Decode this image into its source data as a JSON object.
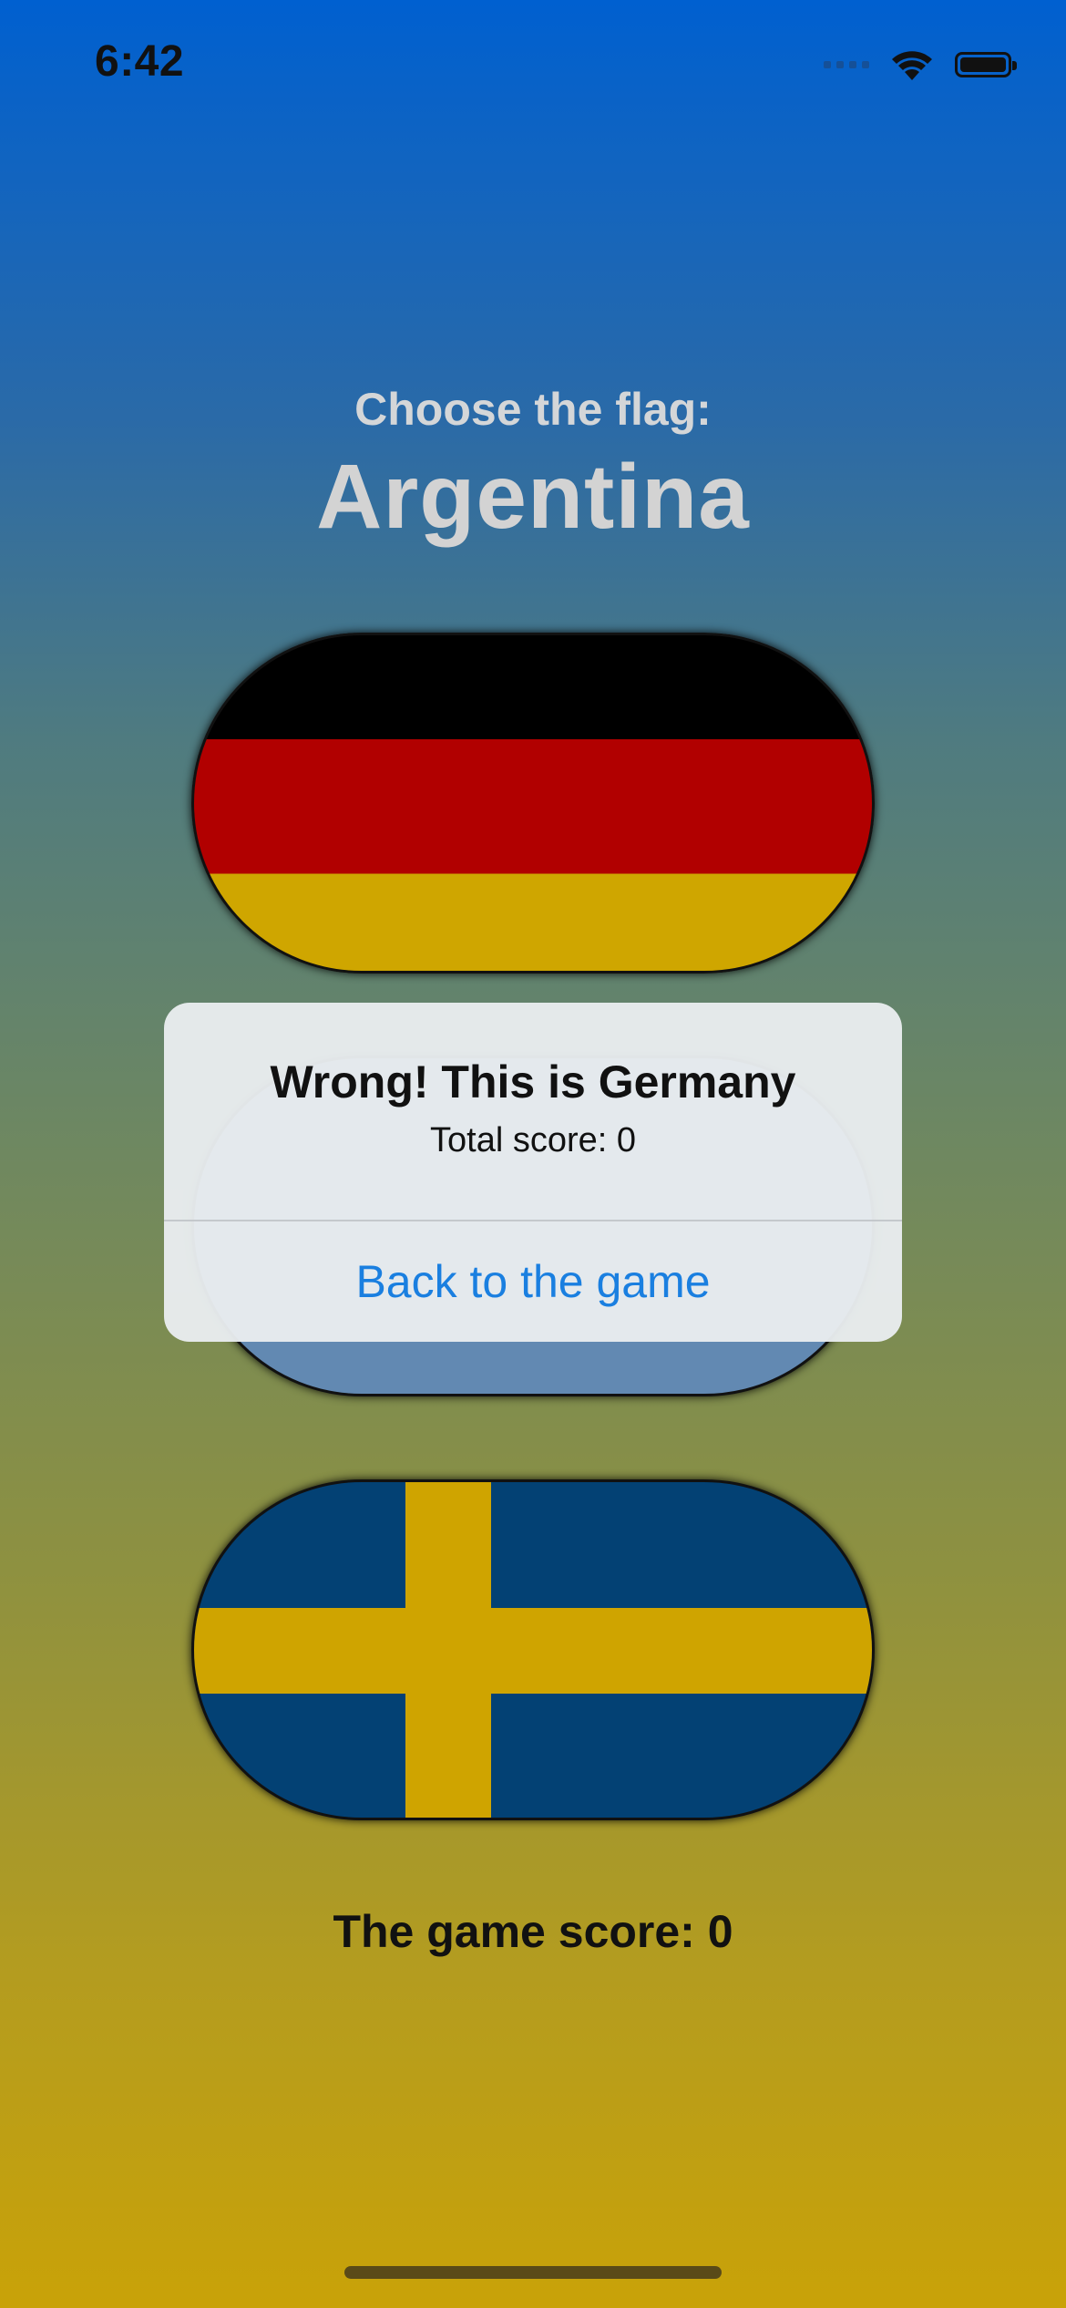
{
  "status_bar": {
    "time": "6:42",
    "icons": [
      "signal-icon",
      "wifi-icon",
      "battery-icon"
    ]
  },
  "header": {
    "prompt": "Choose the flag:",
    "country": "Argentina"
  },
  "flags": [
    {
      "country": "Germany",
      "icon": "germany-flag"
    },
    {
      "country": "Argentina",
      "icon": "argentina-flag"
    },
    {
      "country": "Sweden",
      "icon": "sweden-flag"
    }
  ],
  "score": {
    "label": "The game score: 0"
  },
  "alert": {
    "title": "Wrong! This is Germany",
    "message": "Total score: 0",
    "button_label": "Back to the game"
  },
  "colors": {
    "gradient_top": "#0060d0",
    "gradient_bottom": "#c9a208",
    "alert_button": "#1a7fe0"
  }
}
